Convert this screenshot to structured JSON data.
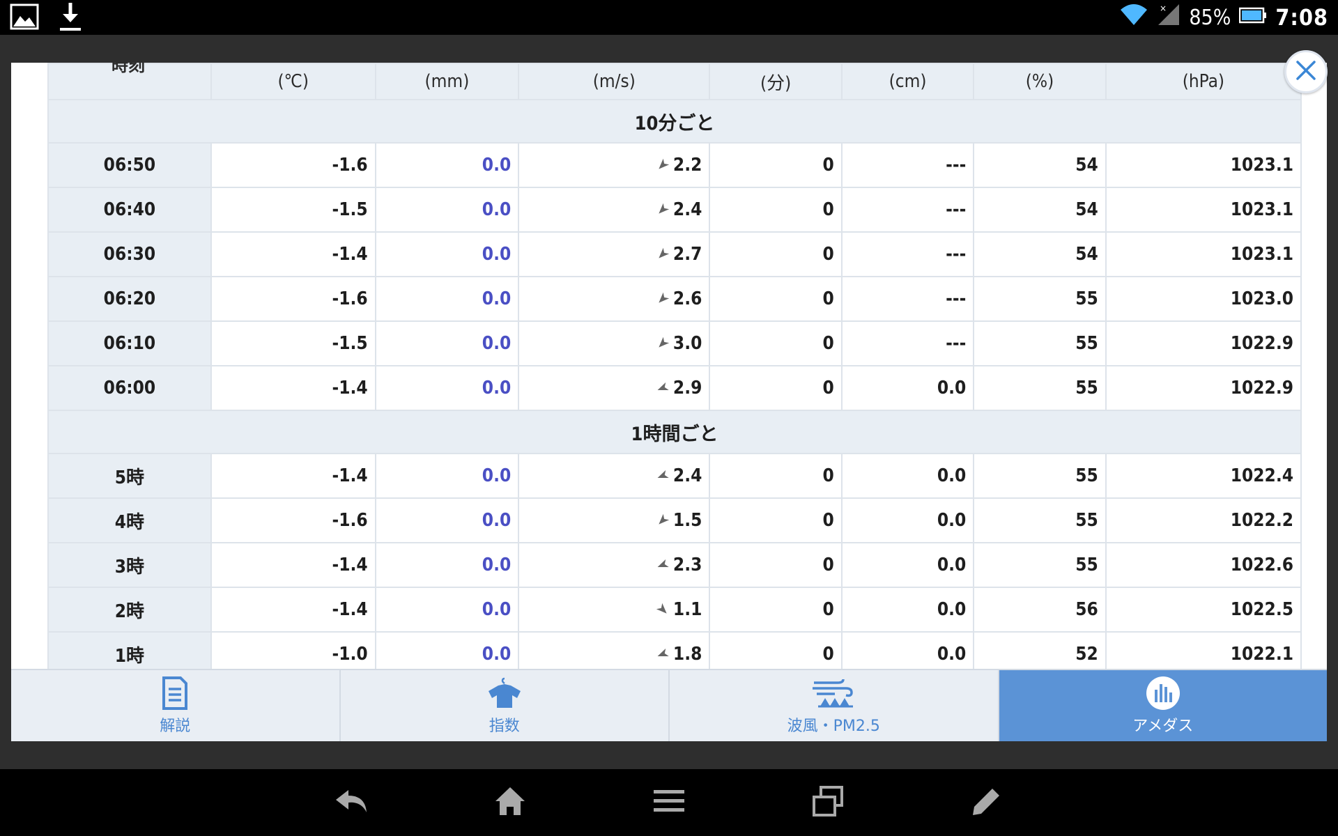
{
  "status_bar": {
    "battery": "85%",
    "clock": "7:08"
  },
  "table": {
    "header_time_partial": "時刻",
    "units": [
      "(℃)",
      "(mm)",
      "(m/s)",
      "(分)",
      "(cm)",
      "(%)",
      "(hPa)"
    ],
    "sections": [
      {
        "title": "10分ごと",
        "rows": [
          {
            "time": "06:50",
            "temp": "-1.6",
            "precip": "0.0",
            "wind_dir": "southwest",
            "wind": "2.2",
            "sun": "0",
            "snow": "---",
            "humidity": "54",
            "pressure": "1023.1"
          },
          {
            "time": "06:40",
            "temp": "-1.5",
            "precip": "0.0",
            "wind_dir": "southwest",
            "wind": "2.4",
            "sun": "0",
            "snow": "---",
            "humidity": "54",
            "pressure": "1023.1"
          },
          {
            "time": "06:30",
            "temp": "-1.4",
            "precip": "0.0",
            "wind_dir": "southwest",
            "wind": "2.7",
            "sun": "0",
            "snow": "---",
            "humidity": "54",
            "pressure": "1023.1"
          },
          {
            "time": "06:20",
            "temp": "-1.6",
            "precip": "0.0",
            "wind_dir": "southwest",
            "wind": "2.6",
            "sun": "0",
            "snow": "---",
            "humidity": "55",
            "pressure": "1023.0"
          },
          {
            "time": "06:10",
            "temp": "-1.5",
            "precip": "0.0",
            "wind_dir": "southwest",
            "wind": "3.0",
            "sun": "0",
            "snow": "---",
            "humidity": "55",
            "pressure": "1022.9"
          },
          {
            "time": "06:00",
            "temp": "-1.4",
            "precip": "0.0",
            "wind_dir": "south-southwest",
            "wind": "2.9",
            "sun": "0",
            "snow": "0.0",
            "humidity": "55",
            "pressure": "1022.9"
          }
        ]
      },
      {
        "title": "1時間ごと",
        "rows": [
          {
            "time": "5時",
            "temp": "-1.4",
            "precip": "0.0",
            "wind_dir": "south-southwest",
            "wind": "2.4",
            "sun": "0",
            "snow": "0.0",
            "humidity": "55",
            "pressure": "1022.4"
          },
          {
            "time": "4時",
            "temp": "-1.6",
            "precip": "0.0",
            "wind_dir": "southwest",
            "wind": "1.5",
            "sun": "0",
            "snow": "0.0",
            "humidity": "55",
            "pressure": "1022.2"
          },
          {
            "time": "3時",
            "temp": "-1.4",
            "precip": "0.0",
            "wind_dir": "south-southwest",
            "wind": "2.3",
            "sun": "0",
            "snow": "0.0",
            "humidity": "55",
            "pressure": "1022.6"
          },
          {
            "time": "2時",
            "temp": "-1.4",
            "precip": "0.0",
            "wind_dir": "northwest",
            "wind": "1.1",
            "sun": "0",
            "snow": "0.0",
            "humidity": "56",
            "pressure": "1022.5"
          },
          {
            "time": "1時",
            "temp": "-1.0",
            "precip": "0.0",
            "wind_dir": "south-southwest",
            "wind": "1.8",
            "sun": "0",
            "snow": "0.0",
            "humidity": "52",
            "pressure": "1022.1"
          }
        ]
      }
    ]
  },
  "tabs": [
    {
      "label": "解説",
      "icon": "document-icon",
      "active": false
    },
    {
      "label": "指数",
      "icon": "shirt-icon",
      "active": false
    },
    {
      "label": "波風・PM2.5",
      "icon": "wind-wave-icon",
      "active": false
    },
    {
      "label": "アメダス",
      "icon": "bar-chart-icon",
      "active": true
    }
  ],
  "colors": {
    "accent": "#5b93d6",
    "precip_text": "#4a4fc4",
    "header_bg": "#e8eef4"
  }
}
